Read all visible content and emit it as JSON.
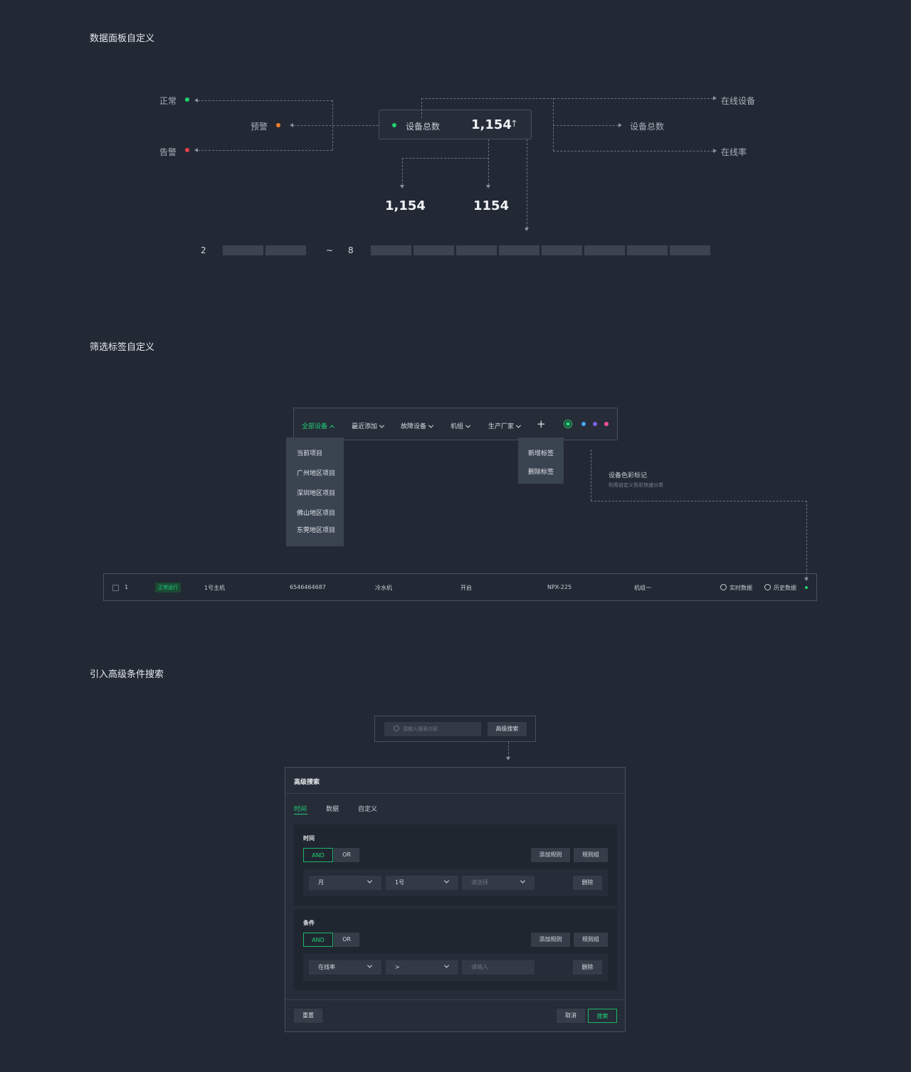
{
  "sections": {
    "dashboard": "数据面板自定义",
    "filter": "筛选标签自定义",
    "advanced": "引入高级条件搜索"
  },
  "dashboard": {
    "status_left": [
      {
        "label": "正常",
        "color": "#1ed36e"
      },
      {
        "label": "预警",
        "color": "#f07f2a"
      },
      {
        "label": "告警",
        "color": "#e8404a"
      }
    ],
    "card": {
      "label": "设备总数",
      "value": "1,154",
      "trend": "↑",
      "dot_color": "#1ed36e"
    },
    "right_labels": [
      "在线设备",
      "设备总数",
      "在线率"
    ],
    "formats": [
      "1,154",
      "1154"
    ],
    "range": {
      "from": "2",
      "sep": "~",
      "to": "8"
    }
  },
  "filter": {
    "tabs": [
      {
        "label": "全部设备",
        "active": true
      },
      {
        "label": "最近添加"
      },
      {
        "label": "故障设备"
      },
      {
        "label": "机组"
      },
      {
        "label": "生产厂家"
      }
    ],
    "add_icon": "plus-icon",
    "colors": [
      "#1ed36e",
      "#3fa9f5",
      "#7b61e8",
      "#f0529a"
    ],
    "dropdown": [
      "当前项目",
      "广州地区项目",
      "深圳地区项目",
      "佛山地区项目",
      "东莞地区项目"
    ],
    "tag_menu": [
      "新增标签",
      "删除标签"
    ],
    "note_title": "设备色彩标记",
    "note_desc": "利用自定义色彩快速分类"
  },
  "table_row": {
    "index": "1",
    "status": "正常运行",
    "name": "1号主机",
    "code": "6546464687",
    "type": "冷水机",
    "state": "开启",
    "model": "NPX-225",
    "group": "机组一",
    "action1": "实时数据",
    "action2": "历史数据",
    "dot_color": "#1ed36e"
  },
  "search": {
    "placeholder": "请输入搜索内容",
    "advanced_btn": "高级搜索"
  },
  "panel": {
    "title": "高级搜索",
    "tabs": [
      "时间",
      "数据",
      "自定义"
    ],
    "block1": {
      "title": "时间",
      "and": "AND",
      "or": "OR",
      "add_rule": "添加规则",
      "rule_group": "规则组",
      "sel1": "月",
      "sel2": "1号",
      "sel3_placeholder": "请选择",
      "delete": "删除"
    },
    "block2": {
      "title": "条件",
      "and": "AND",
      "or": "OR",
      "add_rule": "添加规则",
      "rule_group": "规则组",
      "sel1": "在线率",
      "sel2": ">",
      "input_placeholder": "请输入",
      "delete": "删除"
    },
    "reset": "重置",
    "cancel": "取消",
    "search": "搜索"
  }
}
